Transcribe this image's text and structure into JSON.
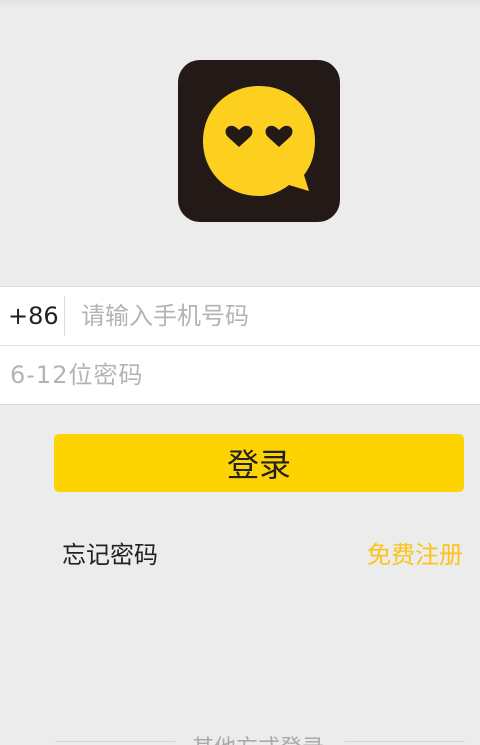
{
  "app": {
    "logo_icon": "chat-bubble-heart-eyes-icon",
    "colors": {
      "background": "#ececec",
      "accent": "#fdd400",
      "logo_bg": "#231a17",
      "register_link": "#fcc31a"
    }
  },
  "login_form": {
    "country_code": "+86",
    "phone_placeholder": "请输入手机号码",
    "password_placeholder": "6-12位密码"
  },
  "actions": {
    "login_label": "登录",
    "forgot_password_label": "忘记密码",
    "register_label": "免费注册"
  },
  "other_login": {
    "label": "其他方式登录"
  }
}
